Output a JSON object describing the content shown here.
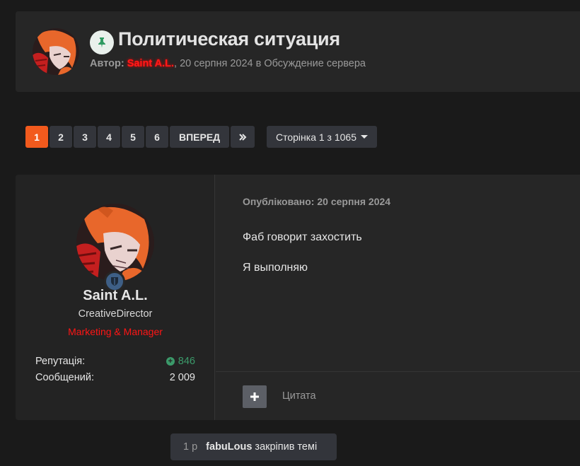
{
  "topic": {
    "title": "Политическая ситуация",
    "author_label": "Автор:",
    "author_name": "Saint A.L.",
    "meta_rest": ", 20 серпня 2024 в Обсуждение сервера",
    "pin_icon": "pin-icon"
  },
  "pagination": {
    "pages": [
      "1",
      "2",
      "3",
      "4",
      "5",
      "6"
    ],
    "active": "1",
    "next_label": "ВПЕРЕД",
    "last_label": "»",
    "dropdown_label": "Сторінка 1 з 1065"
  },
  "post": {
    "author": {
      "name": "Saint A.L.",
      "title": "CreativeDirector",
      "group": "Marketing & Manager",
      "group_color": "#ff1515"
    },
    "stats": {
      "reputation_label": "Репутація:",
      "reputation_value": "846",
      "posts_label": "Сообщений:",
      "posts_value": "2 009"
    },
    "date": "Опубліковано: 20 серпня 2024",
    "lines": [
      "Фаб говорит захостить",
      "Я выполняю"
    ],
    "quote_label": "Цитата"
  },
  "event": {
    "time": "1 р",
    "user": "fabuLous",
    "action": "закріпив темі"
  },
  "colors": {
    "accent": "#f25a1d",
    "author_red": "#ff1a1a",
    "rep_green": "#3b9a6a"
  }
}
